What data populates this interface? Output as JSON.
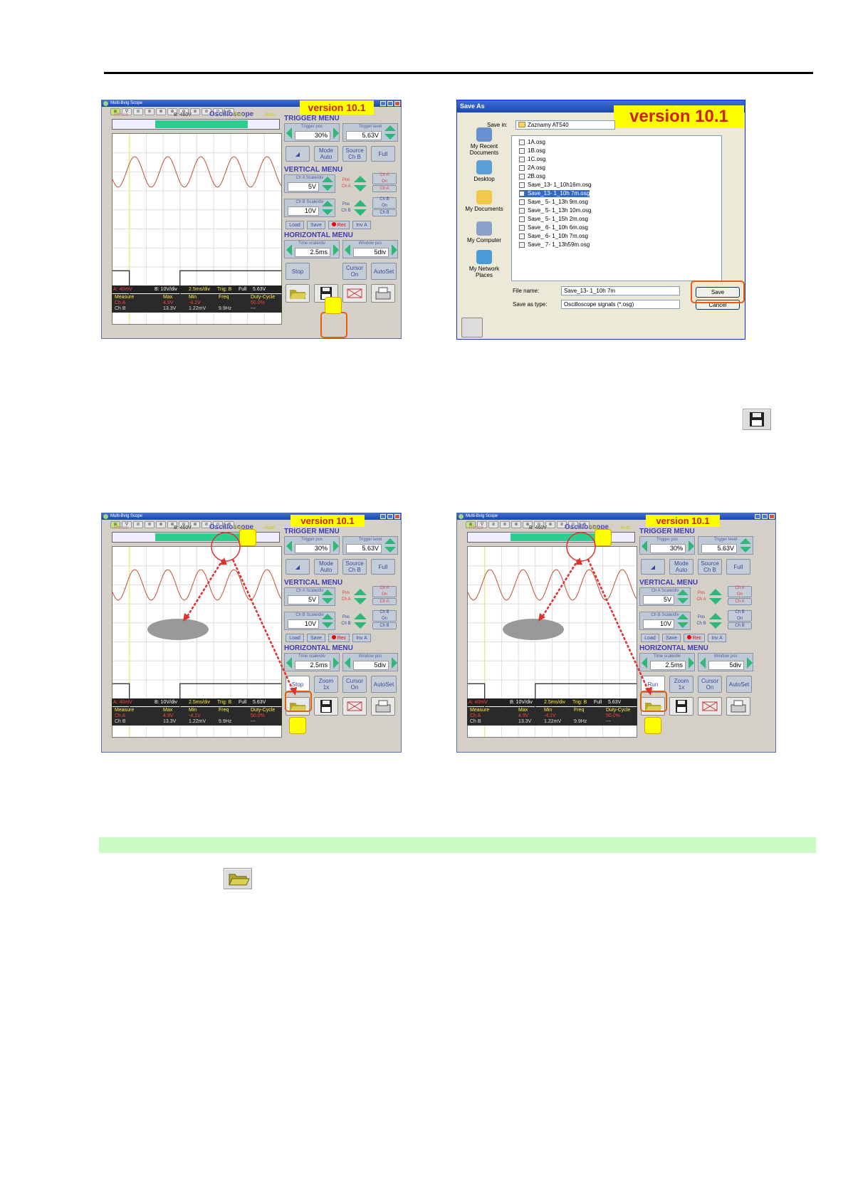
{
  "scope_ui": {
    "window_title": "Multi-Bvig Scope",
    "version_badge": "version 10.1",
    "tools": [
      "⊕",
      "∇",
      "⊘",
      "⊛",
      "⊗",
      "⊕",
      "⊖",
      "⊕",
      "⊘",
      "⊙",
      "⊛"
    ],
    "osc_title": "Oscilloscope",
    "trig_bar": {
      "left": "Phase",
      "center": "B: 460V",
      "state_run": "Run",
      "auto": "Auto"
    },
    "status": {
      "cha": "A: 40mV",
      "chb": "B: 10V/div",
      "time": "2.5ms/div",
      "trig": "Trig: B",
      "full": "Full",
      "level": "5.63V"
    },
    "meas_headers": [
      "Measure",
      "Max",
      "Min",
      "Freq",
      "Duty-Cycle"
    ],
    "meas_cha": [
      "Ch A",
      "4.9V",
      "-4.1V",
      "",
      "50.0%"
    ],
    "meas_chb": [
      "Ch B",
      "13.3V",
      "1.22mV",
      "9.9Hz",
      "---"
    ],
    "trigger_menu": "TRIGGER MENU",
    "trigger_pos_label": "Trigger pos",
    "trigger_pos": "30%",
    "trigger_level_label": "Trigger level",
    "trigger_level": "5.63V",
    "mode_btn": "Mode\nAuto",
    "source_btn": "Source\nCh B",
    "full_btn": "Full",
    "vertical_menu": "VERTICAL MENU",
    "cha_scale_label": "Ch A Scale/div",
    "cha_scale": "5V",
    "pos_cha": "Pos\nCh A",
    "cha_on": "Ch A\nOn",
    "cha_small": "Ch A",
    "chb_scale_label": "Ch B Scale/div",
    "chb_scale": "10V",
    "pos_chb": "Pos\nCh B",
    "chb_on": "Ch B\nOn",
    "chb_small": "Ch B",
    "load_btn": "Load",
    "save_btn": "Save",
    "rec_btn": "Rec",
    "inv_btn": "Inv A",
    "horizontal_menu": "HORIZONTAL MENU",
    "time_scale_label": "Time scale/div",
    "time_scale": "2.5ms",
    "window_pos_label": "Window pos",
    "window_pos": "5div",
    "stop_btn": "Stop",
    "run_btn": "Run",
    "zoom_btn": "Zoom\n1x",
    "cursor_btn": "Cursor\nOn",
    "autoset_btn": "AutoSet"
  },
  "save_dialog": {
    "title": "Save As",
    "version_badge": "version 10.1",
    "save_in_label": "Save in:",
    "save_in_value": "Zaznamy AT540",
    "places": [
      "My Recent\nDocuments",
      "Desktop",
      "My Documents",
      "My Computer",
      "My Network\nPlaces"
    ],
    "files": [
      "1A.osg",
      "1B.osg",
      "1C.osg",
      "2A.osg",
      "2B.osg",
      "Save_13- 1_10h16m.osg",
      "Save_13- 1_10h 7m.osg",
      "Save_ 5- 1_13h 9m.osg",
      "Save_ 5- 1_13h 10m.osg",
      "Save_ 5- 1_15h 2m.osg",
      "Save_ 6- 1_10h 6m.osg",
      "Save_ 6- 1_10h 7m.osg",
      "Save_ 7- 1_13h59m.osg"
    ],
    "selected_index": 6,
    "file_name_label": "File name:",
    "file_name_value": "Save_13- 1_10h 7m",
    "type_label": "Save as type:",
    "type_value": "Oscilloscope signals (*.osg)",
    "save_button": "Save",
    "cancel_button": "Cancel"
  },
  "colors": {
    "accent_green": "#2ecc8e",
    "highlight": "#e06010",
    "band": "#ccfbc6",
    "badge": "#ffff00"
  }
}
